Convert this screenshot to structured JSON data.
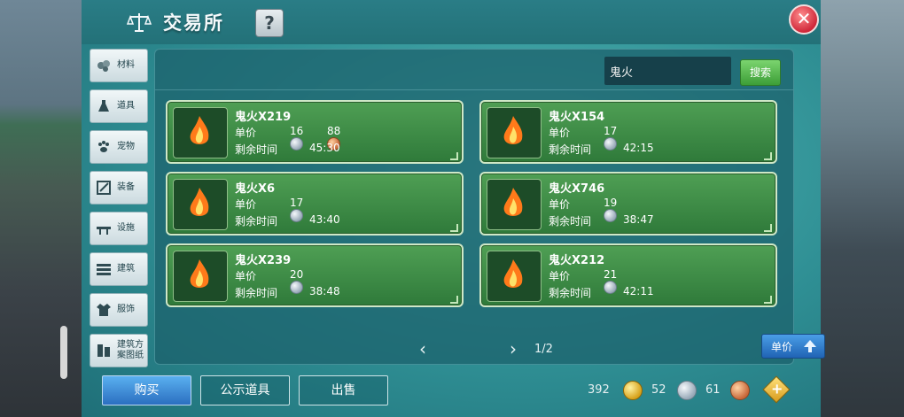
{
  "header": {
    "title": "交易所",
    "help_label": "?",
    "close_label": "✕"
  },
  "categories": [
    {
      "label": "材料",
      "icon": "material-icon"
    },
    {
      "label": "道具",
      "icon": "potion-icon"
    },
    {
      "label": "宠物",
      "icon": "paw-icon"
    },
    {
      "label": "装备",
      "icon": "equipment-icon"
    },
    {
      "label": "设施",
      "icon": "facility-icon"
    },
    {
      "label": "建筑",
      "icon": "building-icon"
    },
    {
      "label": "服饰",
      "icon": "clothing-icon"
    },
    {
      "label": "建筑方案图纸",
      "icon": "blueprint-icon"
    }
  ],
  "search": {
    "value": "鬼火",
    "button_label": "搜索"
  },
  "labels": {
    "unit_price": "单价",
    "remaining_time": "剩余时间"
  },
  "listings": [
    {
      "name": "鬼火X219",
      "price_silver": "16",
      "price_bronze": "88",
      "remaining": "45:30"
    },
    {
      "name": "鬼火X154",
      "price_silver": "17",
      "price_bronze": "",
      "remaining": "42:15"
    },
    {
      "name": "鬼火X6",
      "price_silver": "17",
      "price_bronze": "",
      "remaining": "43:40"
    },
    {
      "name": "鬼火X746",
      "price_silver": "19",
      "price_bronze": "",
      "remaining": "38:47"
    },
    {
      "name": "鬼火X239",
      "price_silver": "20",
      "price_bronze": "",
      "remaining": "38:48"
    },
    {
      "name": "鬼火X212",
      "price_silver": "21",
      "price_bronze": "",
      "remaining": "42:11"
    }
  ],
  "pagination": {
    "page": "1/2",
    "prev": "‹",
    "next": "›"
  },
  "sort": {
    "label": "单价"
  },
  "bottom_tabs": {
    "buy": "购买",
    "public_items": "公示道具",
    "sell": "出售"
  },
  "currency": {
    "gold": "392",
    "silver": "52",
    "bronze": "61"
  }
}
